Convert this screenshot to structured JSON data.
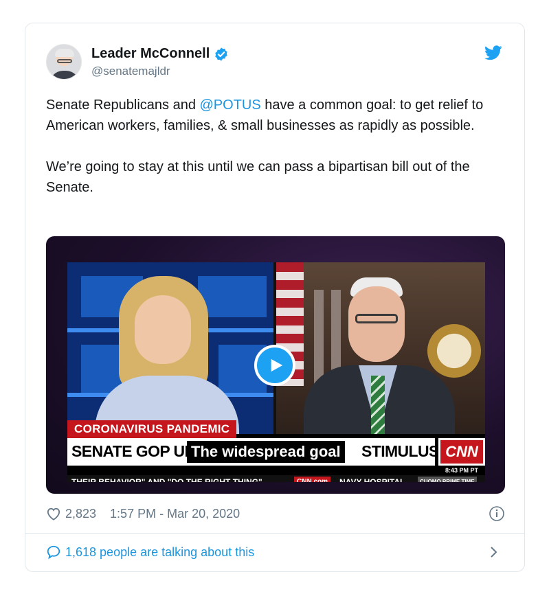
{
  "colors": {
    "link": "#1b95e0",
    "brand": "#1da1f2",
    "muted": "#657786",
    "cnn_red": "#c4161c"
  },
  "author": {
    "display_name": "Leader McConnell",
    "handle": "@senatemajldr",
    "verified": true
  },
  "icons": {
    "bird": "twitter-bird-icon",
    "verified": "verified-badge-icon",
    "play": "play-icon",
    "heart": "heart-icon",
    "info": "info-icon",
    "comment": "comment-icon",
    "chevron": "chevron-right-icon"
  },
  "tweet": {
    "p1_before": "Senate Republicans and ",
    "p1_mention": "@POTUS",
    "p1_after": " have a common goal: to get relief to American workers, families, & small businesses as rapidly as possible.",
    "p2": "We’re going to stay at this until we can pass a bipartisan bill out of the Senate."
  },
  "video": {
    "topic": "CORONAVIRUS PANDEMIC",
    "headline_start": "SENATE GOP UNVE",
    "caption": "The widespread goal",
    "headline_end": "STIMULUS",
    "network": "CNN",
    "time": "8:43 PM PT",
    "ticker_left": "THEIR BEHAVIOR\" AND \"DO THE RIGHT THING\"",
    "ticker_logo": "CNN.com",
    "ticker_right": "NAVY HOSPITAL",
    "ticker_show": "CUOMO PRIME TIME"
  },
  "meta": {
    "likes": "2,823",
    "timestamp": "1:57 PM - Mar 20, 2020"
  },
  "conversation": {
    "label": "1,618 people are talking about this"
  }
}
